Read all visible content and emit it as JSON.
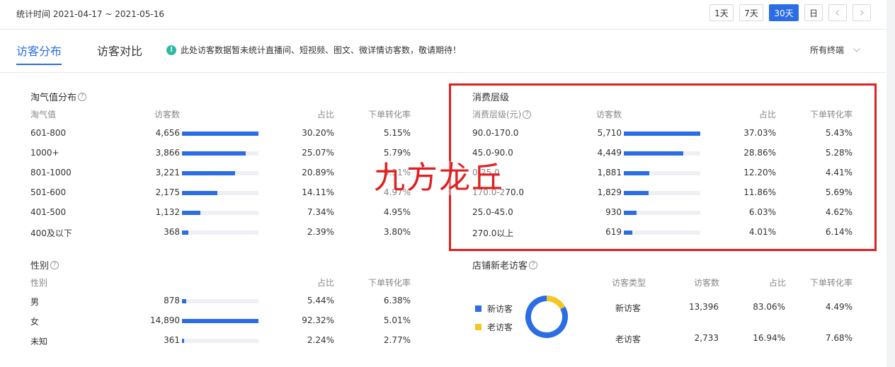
{
  "header": {
    "stat_time": "统计时间 2021-04-17 ~ 2021-05-16",
    "ranges": [
      "1天",
      "7天",
      "30天",
      "日"
    ],
    "active_range": "30天",
    "prev_icon": "chevron-left-icon",
    "next_icon": "chevron-right-icon"
  },
  "tabs": {
    "items": [
      {
        "label": "访客分布"
      },
      {
        "label": "访客对比"
      }
    ],
    "active": "访客分布",
    "notice": "此处访客数据暂未统计直播间、短视频、图文、微详情访客数，敬请期待！",
    "terminal": "所有终端",
    "accent": "#2b6de5",
    "notice_icon_color": "#2fb9a0"
  },
  "taoqi": {
    "title": "淘气值分布",
    "headers": [
      "淘气值",
      "访客数",
      "占比",
      "下单转化率"
    ],
    "rows": [
      {
        "label": "601-800",
        "visitors": "4,656",
        "share": "30.20%",
        "conv": "5.15%",
        "value": 4656
      },
      {
        "label": "1000+",
        "visitors": "3,866",
        "share": "25.07%",
        "conv": "5.79%",
        "value": 3866
      },
      {
        "label": "801-1000",
        "visitors": "3,221",
        "share": "20.89%",
        "conv": "5.31%",
        "value": 3221
      },
      {
        "label": "501-600",
        "visitors": "2,175",
        "share": "14.11%",
        "conv": "4.97%",
        "value": 2175
      },
      {
        "label": "401-500",
        "visitors": "1,132",
        "share": "7.34%",
        "conv": "4.95%",
        "value": 1132
      },
      {
        "label": "400及以下",
        "visitors": "368",
        "share": "2.39%",
        "conv": "3.80%",
        "value": 368
      }
    ],
    "max": 4656
  },
  "consume": {
    "title": "消费层级",
    "headers": [
      "消费层级(元)",
      "访客数",
      "占比",
      "下单转化率"
    ],
    "rows": [
      {
        "label": "90.0-170.0",
        "visitors": "5,710",
        "share": "37.03%",
        "conv": "5.43%",
        "value": 5710
      },
      {
        "label": "45.0-90.0",
        "visitors": "4,449",
        "share": "28.86%",
        "conv": "5.28%",
        "value": 4449
      },
      {
        "label": "0-25.0",
        "visitors": "1,881",
        "share": "12.20%",
        "conv": "4.41%",
        "value": 1881
      },
      {
        "label": "170.0-270.0",
        "visitors": "1,829",
        "share": "11.86%",
        "conv": "5.69%",
        "value": 1829
      },
      {
        "label": "25.0-45.0",
        "visitors": "930",
        "share": "6.03%",
        "conv": "4.62%",
        "value": 930
      },
      {
        "label": "270.0以上",
        "visitors": "619",
        "share": "4.01%",
        "conv": "6.14%",
        "value": 619
      }
    ],
    "max": 5710,
    "highlight_color": "#e02020"
  },
  "gender": {
    "title": "性别",
    "headers": [
      "性别",
      "占比",
      "下单转化率"
    ],
    "rows": [
      {
        "label": "男",
        "visitors": "878",
        "share": "5.44%",
        "conv": "6.38%",
        "value": 878
      },
      {
        "label": "女",
        "visitors": "14,890",
        "share": "92.32%",
        "conv": "5.01%",
        "value": 14890
      },
      {
        "label": "未知",
        "visitors": "361",
        "share": "2.24%",
        "conv": "2.77%",
        "value": 361
      }
    ],
    "max": 14890
  },
  "newold": {
    "title": "店铺新老访客",
    "headers": [
      "访客类型",
      "访客数",
      "占比",
      "下单转化率"
    ],
    "legend": [
      {
        "label": "新访客",
        "color": "#2b6de5"
      },
      {
        "label": "老访客",
        "color": "#f5c623"
      }
    ],
    "rows": [
      {
        "label": "新访客",
        "visitors": "13,396",
        "share": "83.06%",
        "conv": "4.49%",
        "value": 13396
      },
      {
        "label": "老访客",
        "visitors": "2,733",
        "share": "16.94%",
        "conv": "7.68%",
        "value": 2733
      }
    ]
  },
  "watermark": "九方龙丘"
}
